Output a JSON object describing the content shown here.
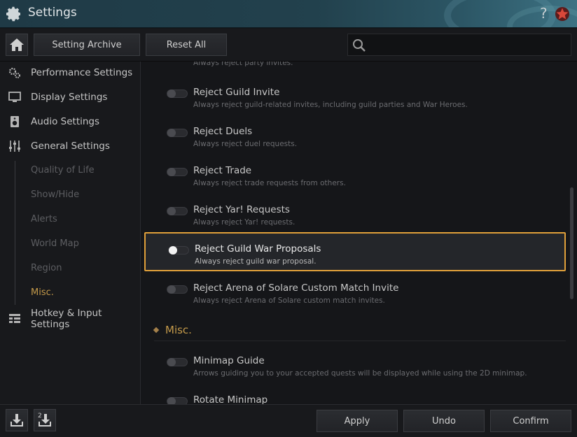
{
  "window": {
    "title": "Settings",
    "help": "?"
  },
  "toolbar": {
    "archive_label": "Setting Archive",
    "reset_label": "Reset All",
    "search_value": ""
  },
  "sidebar": {
    "items": [
      {
        "label": "Performance Settings",
        "icon": "performance-gears-icon"
      },
      {
        "label": "Display Settings",
        "icon": "monitor-icon"
      },
      {
        "label": "Audio Settings",
        "icon": "speaker-icon"
      },
      {
        "label": "General Settings",
        "icon": "sliders-icon"
      },
      {
        "label": "Hotkey & Input Settings",
        "icon": "keyboard-layout-icon"
      }
    ],
    "sub_items": [
      "Quality of Life",
      "Show/Hide",
      "Alerts",
      "World Map",
      "Region",
      "Misc."
    ],
    "active_sub": "Misc."
  },
  "content": {
    "partial_top_desc": "Always reject party invites.",
    "rows": [
      {
        "title": "Reject Guild Invite",
        "desc": "Always reject guild-related invites, including guild parties and War Heroes."
      },
      {
        "title": "Reject Duels",
        "desc": "Always reject duel requests."
      },
      {
        "title": "Reject Trade",
        "desc": "Always reject trade requests from others."
      },
      {
        "title": "Reject Yar! Requests",
        "desc": "Always reject Yar! requests."
      },
      {
        "title": "Reject Guild War Proposals",
        "desc": "Always reject guild war proposal."
      },
      {
        "title": "Reject Arena of Solare Custom Match Invite",
        "desc": "Always reject Arena of Solare custom match invites."
      }
    ],
    "section": "Misc.",
    "misc_rows": [
      {
        "title": "Minimap Guide",
        "desc": "Arrows guiding you to your accepted quests will be displayed while using the 2D minimap."
      },
      {
        "title": "Rotate Minimap",
        "desc": ""
      }
    ]
  },
  "footer": {
    "apply_label": "Apply",
    "undo_label": "Undo",
    "confirm_label": "Confirm"
  },
  "colors": {
    "accent_gold": "#c49a4a",
    "highlight_border": "#e0a03a",
    "title_bar": "#22414d"
  }
}
